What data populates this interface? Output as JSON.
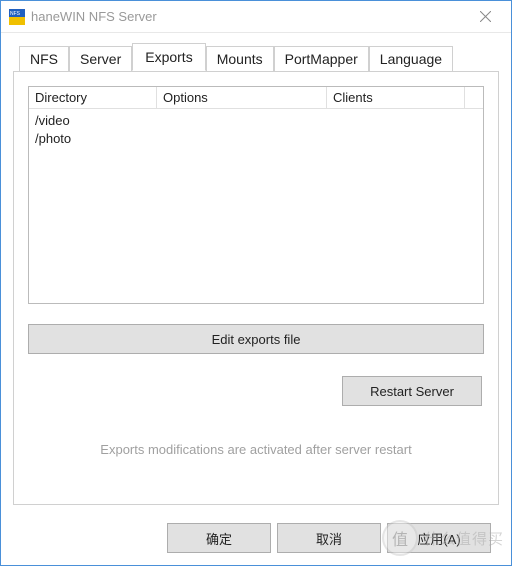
{
  "window": {
    "title": "haneWIN NFS Server"
  },
  "tabs": {
    "nfs": "NFS",
    "server": "Server",
    "exports": "Exports",
    "mounts": "Mounts",
    "portmapper": "PortMapper",
    "language": "Language"
  },
  "listview": {
    "columns": {
      "directory": "Directory",
      "options": "Options",
      "clients": "Clients"
    },
    "rows": [
      {
        "directory": "/video",
        "options": "",
        "clients": ""
      },
      {
        "directory": "/photo",
        "options": "",
        "clients": ""
      }
    ]
  },
  "buttons": {
    "edit_exports": "Edit exports file",
    "restart_server": "Restart Server",
    "ok": "确定",
    "cancel": "取消",
    "apply": "应用(A)"
  },
  "status": {
    "message": "Exports modifications are activated after server restart"
  },
  "watermark": {
    "badge": "值",
    "text": "什么值得买"
  }
}
